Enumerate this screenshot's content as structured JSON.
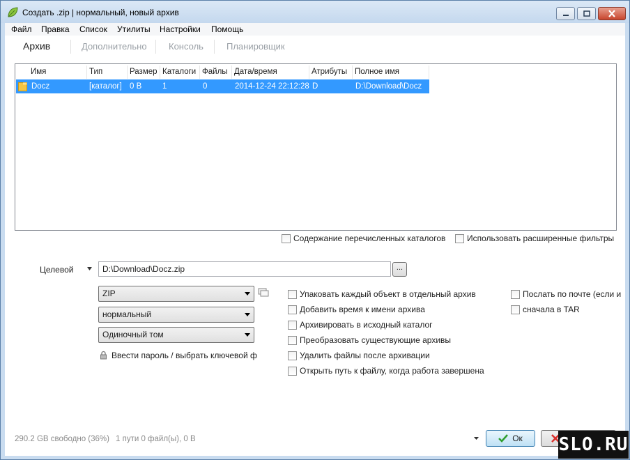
{
  "window": {
    "title": "Создать .zip | нормальный, новый архив"
  },
  "menu": [
    "Файл",
    "Правка",
    "Список",
    "Утилиты",
    "Настройки",
    "Помощь"
  ],
  "tabs": [
    "Архив",
    "Дополнительно",
    "Консоль",
    "Планировщик"
  ],
  "filelist": {
    "columns": [
      "Имя",
      "Тип",
      "Размер",
      "Каталоги",
      "Файлы",
      "Дата/время",
      "Атрибуты",
      "Полное имя"
    ],
    "rows": [
      {
        "name": "Docz",
        "type": "[каталог]",
        "size": "0 B",
        "dirs": "1",
        "files": "0",
        "datetime": "2014-12-24 22:12:28",
        "attrs": "D",
        "fullname": "D:\\Download\\Docz"
      }
    ]
  },
  "list_options": {
    "include_dirs": "Содержание перечисленных каталогов",
    "advanced_filters": "Использовать расширенные фильтры"
  },
  "target": {
    "label": "Целевой",
    "value": "D:\\Download\\Docz.zip",
    "browse_label": "..."
  },
  "selects": {
    "format": "ZIP",
    "compression": "нормальный",
    "volume": "Одиночный том"
  },
  "password_link": "Ввести пароль / выбрать ключевой ф",
  "options_left": [
    "Упаковать каждый объект в отдельный архив",
    "Добавить время к имени архива",
    "Архивировать в исходный каталог",
    "Преобразовать существующие архивы",
    "Удалить файлы после архивации",
    "Открыть путь к файлу, когда работа завершена"
  ],
  "options_right": [
    "Послать по почте (если и",
    "сначала в TAR"
  ],
  "status": {
    "free_space": "290.2 GB свободно (36%)",
    "summary": "1 пути 0 файл(ы), 0 B"
  },
  "buttons": {
    "ok": "Ок"
  },
  "watermark": "SLO.RU",
  "colors": {
    "selection": "#3399ff",
    "folder": "#f5c542",
    "ok_check": "#2e9e2e",
    "cancel_x": "#d9302c"
  }
}
